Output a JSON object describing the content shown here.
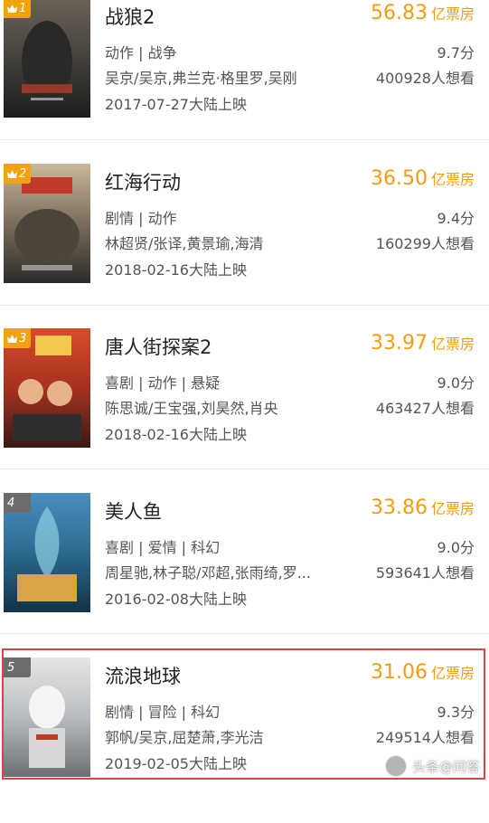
{
  "movies": [
    {
      "rank": "1",
      "title": "战狼2",
      "box_num": "56.83",
      "box_unit": "亿票房",
      "genre": "动作 | 战争",
      "score": "9.7分",
      "cast": "吴京/吴京,弗兰克·格里罗,吴刚",
      "want": "400928人想看",
      "date": "2017-07-27大陆上映"
    },
    {
      "rank": "2",
      "title": "红海行动",
      "box_num": "36.50",
      "box_unit": "亿票房",
      "genre": "剧情 | 动作",
      "score": "9.4分",
      "cast": "林超贤/张译,黄景瑜,海清",
      "want": "160299人想看",
      "date": "2018-02-16大陆上映"
    },
    {
      "rank": "3",
      "title": "唐人街探案2",
      "box_num": "33.97",
      "box_unit": "亿票房",
      "genre": "喜剧 | 动作 | 悬疑",
      "score": "9.0分",
      "cast": "陈思诚/王宝强,刘昊然,肖央",
      "want": "463427人想看",
      "date": "2018-02-16大陆上映"
    },
    {
      "rank": "4",
      "title": "美人鱼",
      "box_num": "33.86",
      "box_unit": "亿票房",
      "genre": "喜剧 | 爱情 | 科幻",
      "score": "9.0分",
      "cast": "周星驰,林子聪/邓超,张雨绮,罗...",
      "want": "593641人想看",
      "date": "2016-02-08大陆上映"
    },
    {
      "rank": "5",
      "title": "流浪地球",
      "box_num": "31.06",
      "box_unit": "亿票房",
      "genre": "剧情 | 冒险 | 科幻",
      "score": "9.3分",
      "cast": "郭帆/吴京,屈楚萧,李光洁",
      "want": "249514人想看",
      "date": "2019-02-05大陆上映"
    }
  ],
  "watermark": {
    "text": "头条@问答"
  },
  "colors": {
    "accent": "#f39c12",
    "rank_gold": "#f0a30a",
    "rank_plain": "#6c6c6c",
    "highlight": "#d94448"
  }
}
